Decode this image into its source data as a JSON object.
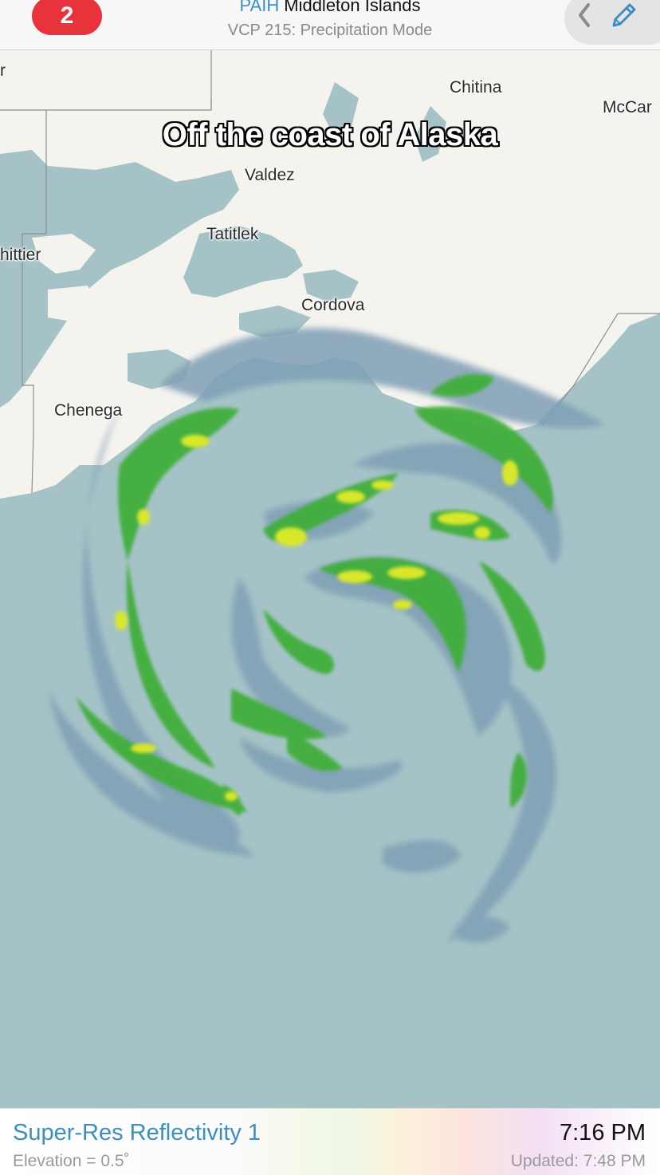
{
  "header": {
    "alert_count": "2",
    "station_code": "PAIH",
    "station_name": "Middleton Islands",
    "vcp_mode": "VCP 215: Precipitation Mode",
    "back_icon": "chevron-left-icon",
    "edit_icon": "pencil-icon"
  },
  "map": {
    "caption": "Off the coast of Alaska",
    "cities": {
      "chitina": "Chitina",
      "mccarthy": "McCar",
      "valdez": "Valdez",
      "tatitlek": "Tatitlek",
      "whittier": "hittier",
      "cordova": "Cordova",
      "chenega": "Chenega",
      "edge_label": "r"
    },
    "colors": {
      "land": "#f5f3ee",
      "water": "#a5c3c7",
      "echo_light": "#7f9fb5",
      "echo_green": "#3fae3a",
      "echo_bright_green": "#7fd23a",
      "echo_yellow": "#e8e82a"
    }
  },
  "footer": {
    "product": "Super-Res Reflectivity 1",
    "elevation": "Elevation = 0.5˚",
    "scan_time": "7:16 PM",
    "updated": "Updated: 7:48 PM"
  }
}
